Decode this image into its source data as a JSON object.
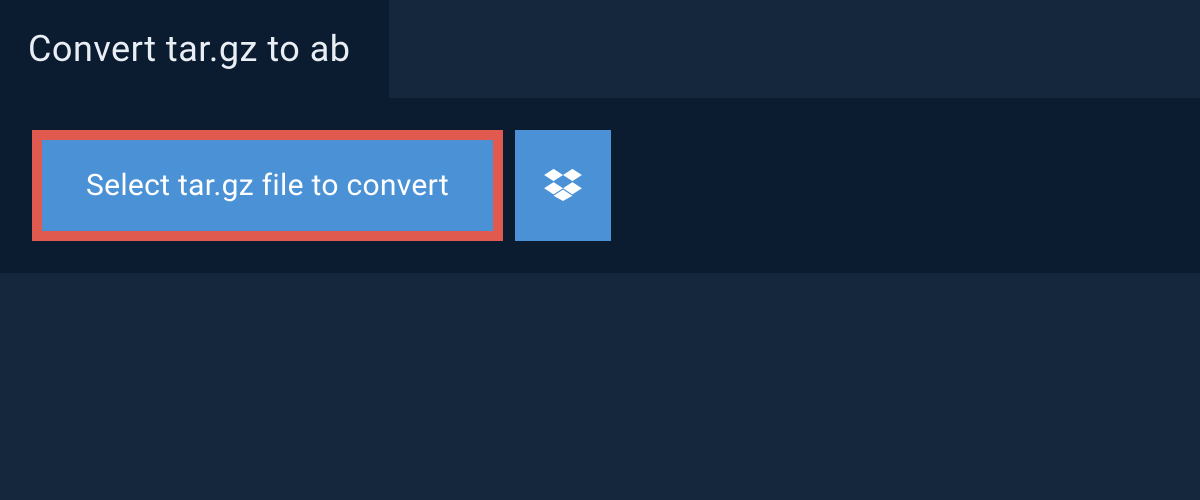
{
  "tab": {
    "title": "Convert tar.gz to ab"
  },
  "actions": {
    "select_file_label": "Select tar.gz file to convert"
  }
}
